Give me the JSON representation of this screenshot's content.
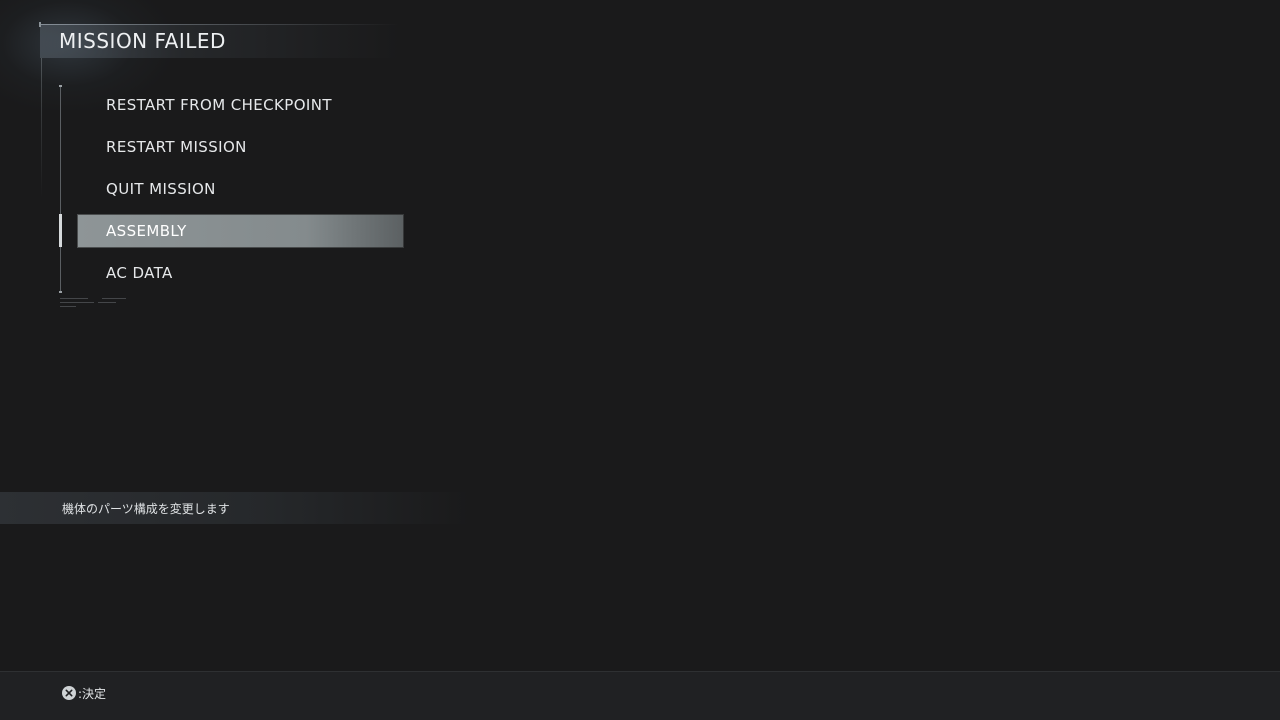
{
  "header": {
    "title": "MISSION FAILED"
  },
  "menu": {
    "items": [
      {
        "label": "RESTART FROM CHECKPOINT",
        "selected": false
      },
      {
        "label": "RESTART MISSION",
        "selected": false
      },
      {
        "label": "QUIT MISSION",
        "selected": false
      },
      {
        "label": "ASSEMBLY",
        "selected": true
      },
      {
        "label": "AC DATA",
        "selected": false
      }
    ]
  },
  "description": {
    "text": "機体のパーツ構成を変更します"
  },
  "footer": {
    "confirm_button_icon": "cross-button-icon",
    "confirm_label": ":決定"
  },
  "colors": {
    "background": "#1a1a1b",
    "selected_item": "#8e9597",
    "text": "#e6e8ea",
    "footer": "#202123"
  }
}
